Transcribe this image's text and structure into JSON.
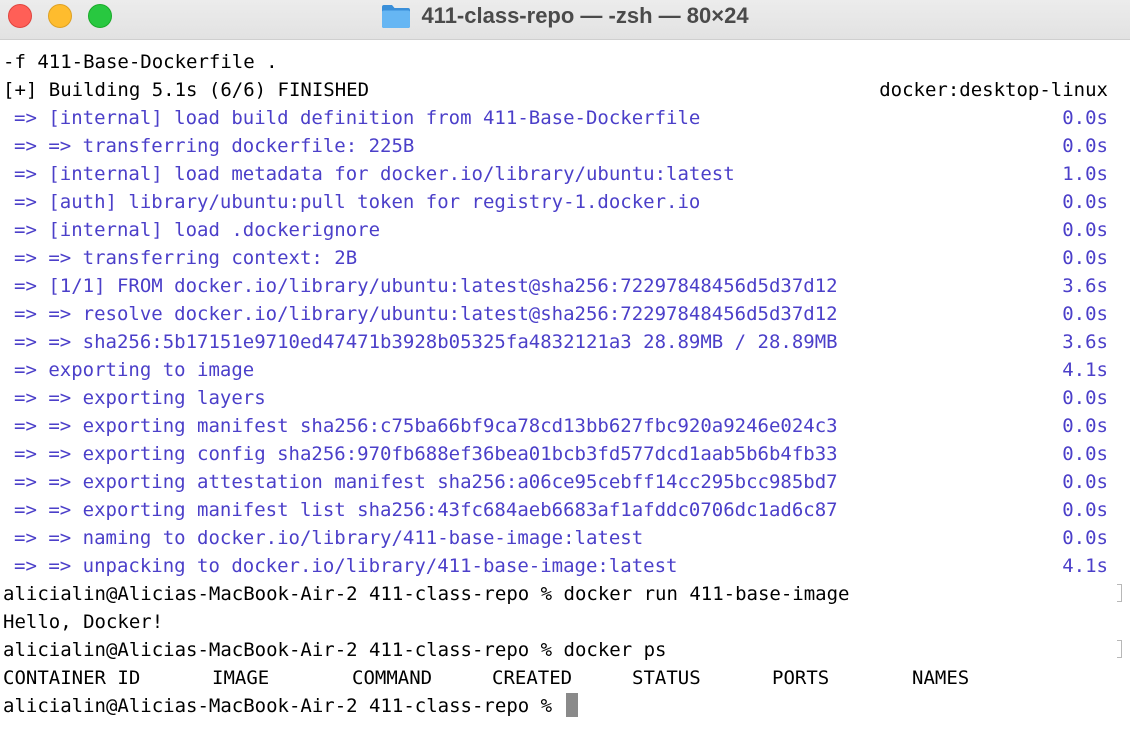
{
  "window": {
    "title": "411-class-repo — -zsh — 80×24"
  },
  "terminal": {
    "line_cmd_tail": "-f 411-Base-Dockerfile .",
    "building": {
      "text": "[+] Building 5.1s (6/6) FINISHED",
      "context": "docker:desktop-linux"
    },
    "steps": [
      {
        "text": "=> [internal] load build definition from 411-Base-Dockerfile",
        "time": "0.0s"
      },
      {
        "text": "=> => transferring dockerfile: 225B",
        "time": "0.0s"
      },
      {
        "text": "=> [internal] load metadata for docker.io/library/ubuntu:latest",
        "time": "1.0s"
      },
      {
        "text": "=> [auth] library/ubuntu:pull token for registry-1.docker.io",
        "time": "0.0s"
      },
      {
        "text": "=> [internal] load .dockerignore",
        "time": "0.0s"
      },
      {
        "text": "=> => transferring context: 2B",
        "time": "0.0s"
      },
      {
        "text": "=> [1/1] FROM docker.io/library/ubuntu:latest@sha256:72297848456d5d37d12",
        "time": "3.6s"
      },
      {
        "text": "=> => resolve docker.io/library/ubuntu:latest@sha256:72297848456d5d37d12",
        "time": "0.0s"
      },
      {
        "text": "=> => sha256:5b17151e9710ed47471b3928b05325fa4832121a3 28.89MB / 28.89MB",
        "time": "3.6s"
      },
      {
        "text": "=> exporting to image",
        "time": "4.1s"
      },
      {
        "text": "=> => exporting layers",
        "time": "0.0s"
      },
      {
        "text": "=> => exporting manifest sha256:c75ba66bf9ca78cd13bb627fbc920a9246e024c3",
        "time": "0.0s"
      },
      {
        "text": "=> => exporting config sha256:970fb688ef36bea01bcb3fd577dcd1aab5b6b4fb33",
        "time": "0.0s"
      },
      {
        "text": "=> => exporting attestation manifest sha256:a06ce95cebff14cc295bcc985bd7",
        "time": "0.0s"
      },
      {
        "text": "=> => exporting manifest list sha256:43fc684aeb6683af1afddc0706dc1ad6c87",
        "time": "0.0s"
      },
      {
        "text": "=> => naming to docker.io/library/411-base-image:latest",
        "time": "0.0s"
      },
      {
        "text": "=> => unpacking to docker.io/library/411-base-image:latest",
        "time": "4.1s"
      }
    ],
    "prompt1": "alicialin@Alicias-MacBook-Air-2 411-class-repo % docker run 411-base-image",
    "output1": "Hello, Docker!",
    "prompt2": "alicialin@Alicias-MacBook-Air-2 411-class-repo % docker ps",
    "ps_headers": {
      "container_id": "CONTAINER ID",
      "image": "IMAGE",
      "command": "COMMAND",
      "created": "CREATED",
      "status": "STATUS",
      "ports": "PORTS",
      "names": "NAMES"
    },
    "prompt3": "alicialin@Alicias-MacBook-Air-2 411-class-repo % "
  },
  "colors": {
    "step_text": "#4b3fc9",
    "close": "#ff5f57",
    "minimize": "#febc2e",
    "maximize": "#28c840"
  }
}
